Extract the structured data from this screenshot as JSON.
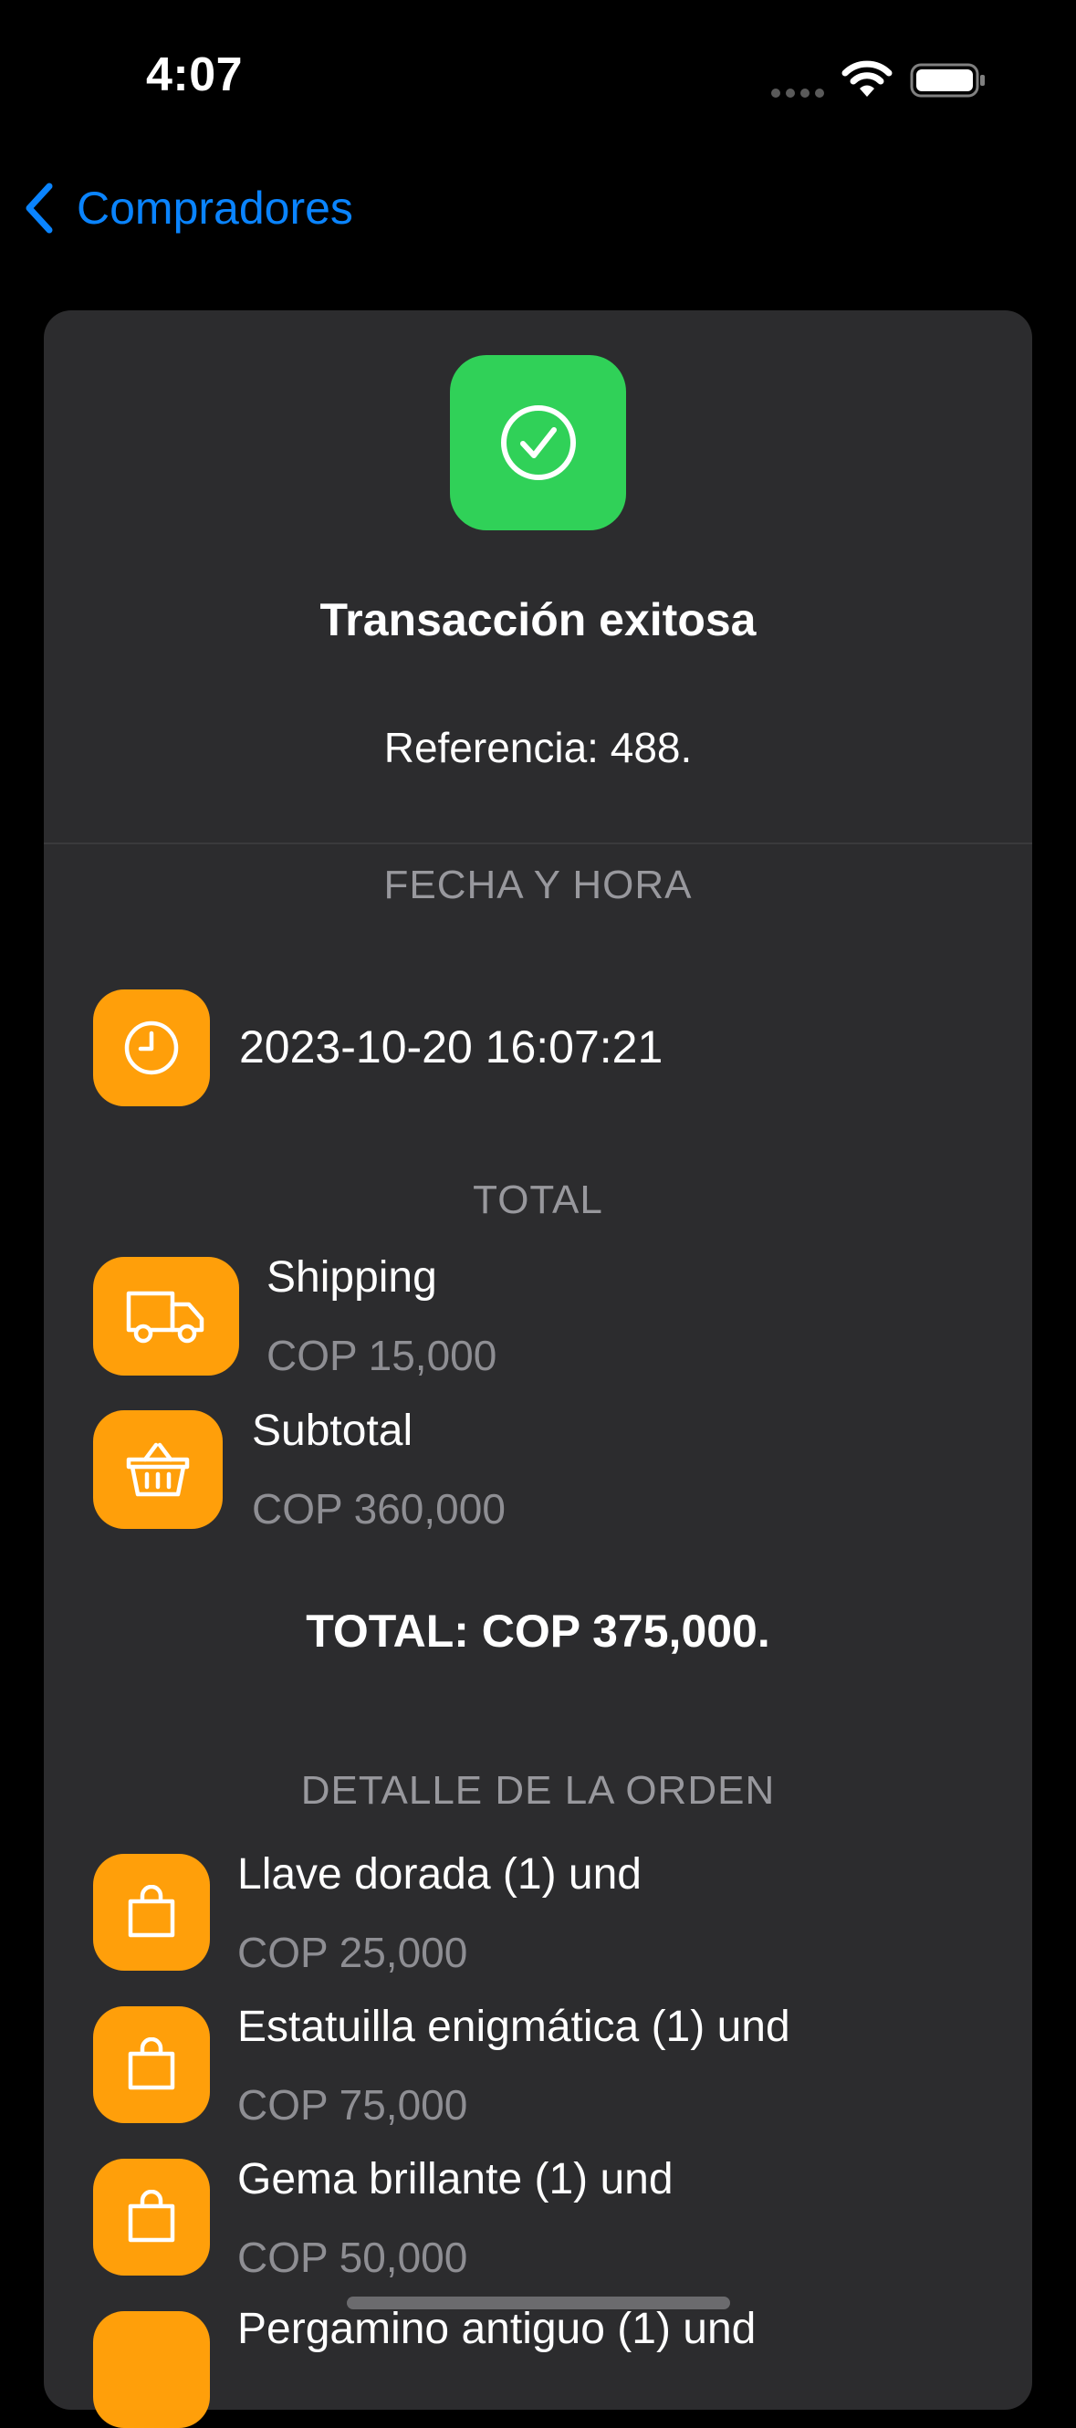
{
  "status_bar": {
    "time": "4:07",
    "icons": [
      "cell-signal-icon",
      "wifi-icon",
      "battery-icon"
    ]
  },
  "nav": {
    "back_label": "Compradores",
    "back_icon": "chevron-left-icon",
    "accent_color": "#0a84ff"
  },
  "card": {
    "status_icon": "checkmark-circle-icon",
    "status_color": "#30d158",
    "title": "Transacción exitosa",
    "reference": "Referencia: 488."
  },
  "sections": {
    "datetime_header": "FECHA Y HORA",
    "total_header": "TOTAL",
    "order_header": "DETALLE DE LA ORDEN"
  },
  "datetime": {
    "icon": "clock-icon",
    "value": "2023-10-20 16:07:21"
  },
  "totals": {
    "shipping": {
      "icon": "truck-icon",
      "label": "Shipping",
      "amount": "COP 15,000"
    },
    "subtotal": {
      "icon": "basket-icon",
      "label": "Subtotal",
      "amount": "COP 360,000"
    },
    "total_line": "TOTAL: COP 375,000."
  },
  "order_items": [
    {
      "icon": "bag-icon",
      "label": "Llave dorada (1) und",
      "amount": "COP 25,000"
    },
    {
      "icon": "bag-icon",
      "label": "Estatuilla enigmática (1) und",
      "amount": "COP 75,000"
    },
    {
      "icon": "bag-icon",
      "label": "Gema brillante (1) und",
      "amount": "COP 50,000"
    },
    {
      "icon": "bag-icon",
      "label": "Pergamino antiguo (1) und",
      "amount": ""
    }
  ],
  "colors": {
    "icon_background": "#ff9f0a",
    "card_background": "#2c2c2e",
    "secondary_text": "#8e8e93"
  }
}
